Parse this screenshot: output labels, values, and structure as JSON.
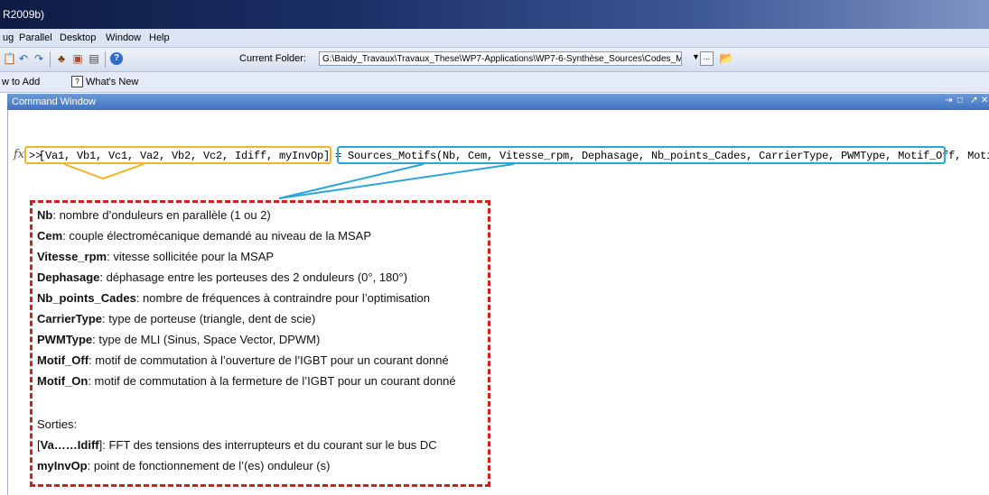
{
  "window": {
    "title": "R2009b)"
  },
  "menu": [
    "ug",
    "Parallel",
    "Desktop",
    "Window",
    "Help"
  ],
  "toolbar": {
    "current_folder_label": "Current Folder:",
    "current_folder_path": "G:\\Baidy_Travaux\\Travaux_These\\WP7-Applications\\WP7-6-Synthèse_Sources\\Codes_Matlab",
    "browse_label": "..."
  },
  "shortcuts": {
    "how_to_add": "w to Add",
    "whats_new": "What's New"
  },
  "command_window": {
    "title": "Command Window",
    "fx": "fx",
    "prompt": ">>",
    "outputs": "[Va1, Vb1, Vc1, Va2, Vb2, Vc2, Idiff, myInvOp]",
    "equals": "=",
    "call": "Sources_Motifs(Nb, Cem, Vitesse_rpm, Dephasage, Nb_points_Cades, CarrierType, PWMType, Motif_Off, Motif_On);"
  },
  "notes": [
    {
      "key": "Nb",
      "text": ": nombre d’onduleurs en parallèle (1 ou 2)"
    },
    {
      "key": "Cem",
      "text": ": couple électromécanique demandé au niveau de la MSAP"
    },
    {
      "key": "Vitesse_rpm",
      "text": ": vitesse sollicitée pour la MSAP"
    },
    {
      "key": "Dephasage",
      "text": ": déphasage entre les porteuses des 2 onduleurs (0°, 180°)"
    },
    {
      "key": "Nb_points_Cades",
      "text": ":  nombre de fréquences à contraindre pour l’optimisation"
    },
    {
      "key": "CarrierType",
      "text": ": type de porteuse (triangle, dent de scie)"
    },
    {
      "key": "PWMType",
      "text": ": type de MLI (Sinus, Space Vector, DPWM)"
    },
    {
      "key": "Motif_Off",
      "text": ": motif de commutation à l’ouverture de l’IGBT pour un courant donné"
    },
    {
      "key": "Motif_On",
      "text": ": motif de commutation à la fermeture de l’IGBT pour un courant donné"
    }
  ],
  "outputs_section": {
    "heading": "Sorties:",
    "va_prefix": "[",
    "va_key": "Va……Idiff",
    "va_text": "]: FFT des tensions des interrupteurs et du courant sur le bus DC",
    "inv_key": "myInvOp",
    "inv_text": ": point de fonctionnement de l’(es) onduleur (s)"
  },
  "colors": {
    "output_highlight": "#f2b52a",
    "input_highlight": "#2ba6d8",
    "note_border": "#d21f1f"
  }
}
